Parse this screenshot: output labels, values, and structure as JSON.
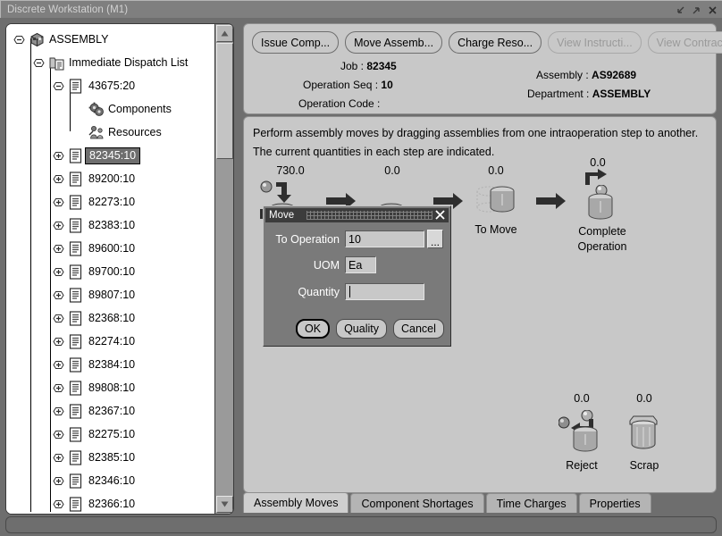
{
  "window": {
    "title": "Discrete Workstation (M1)",
    "controls": [
      {
        "name": "minimize-button",
        "glyph": "minimize"
      },
      {
        "name": "maximize-button",
        "glyph": "maximize"
      },
      {
        "name": "close-button",
        "glyph": "close"
      }
    ]
  },
  "tree": {
    "nodes": [
      {
        "label": "ASSEMBLY",
        "depth": 0,
        "icon": "cube-icon",
        "handle": "collapse",
        "selected": false
      },
      {
        "label": "Immediate Dispatch List",
        "depth": 1,
        "icon": "folder-doc-icon",
        "handle": "collapse",
        "selected": false
      },
      {
        "label": "43675:20",
        "depth": 2,
        "icon": "document-icon",
        "handle": "collapse",
        "selected": false
      },
      {
        "label": "Components",
        "depth": 3,
        "icon": "gears-icon",
        "handle": "none",
        "selected": false
      },
      {
        "label": "Resources",
        "depth": 3,
        "icon": "resources-icon",
        "handle": "none",
        "selected": false
      },
      {
        "label": "82345:10",
        "depth": 2,
        "icon": "document-icon",
        "handle": "expand",
        "selected": true
      },
      {
        "label": "89200:10",
        "depth": 2,
        "icon": "document-icon",
        "handle": "expand",
        "selected": false
      },
      {
        "label": "82273:10",
        "depth": 2,
        "icon": "document-icon",
        "handle": "expand",
        "selected": false
      },
      {
        "label": "82383:10",
        "depth": 2,
        "icon": "document-icon",
        "handle": "expand",
        "selected": false
      },
      {
        "label": "89600:10",
        "depth": 2,
        "icon": "document-icon",
        "handle": "expand",
        "selected": false
      },
      {
        "label": "89700:10",
        "depth": 2,
        "icon": "document-icon",
        "handle": "expand",
        "selected": false
      },
      {
        "label": "89807:10",
        "depth": 2,
        "icon": "document-icon",
        "handle": "expand",
        "selected": false
      },
      {
        "label": "82368:10",
        "depth": 2,
        "icon": "document-icon",
        "handle": "expand",
        "selected": false
      },
      {
        "label": "82274:10",
        "depth": 2,
        "icon": "document-icon",
        "handle": "expand",
        "selected": false
      },
      {
        "label": "82384:10",
        "depth": 2,
        "icon": "document-icon",
        "handle": "expand",
        "selected": false
      },
      {
        "label": "89808:10",
        "depth": 2,
        "icon": "document-icon",
        "handle": "expand",
        "selected": false
      },
      {
        "label": "82367:10",
        "depth": 2,
        "icon": "document-icon",
        "handle": "expand",
        "selected": false
      },
      {
        "label": "82275:10",
        "depth": 2,
        "icon": "document-icon",
        "handle": "expand",
        "selected": false
      },
      {
        "label": "82385:10",
        "depth": 2,
        "icon": "document-icon",
        "handle": "expand",
        "selected": false
      },
      {
        "label": "82346:10",
        "depth": 2,
        "icon": "document-icon",
        "handle": "expand",
        "selected": false
      },
      {
        "label": "82366:10",
        "depth": 2,
        "icon": "document-icon",
        "handle": "expand",
        "selected": false
      }
    ]
  },
  "toolbar": {
    "buttons": [
      {
        "label": "Issue Comp...",
        "name": "issue-components-button",
        "disabled": false
      },
      {
        "label": "Move Assemb...",
        "name": "move-assemblies-button",
        "disabled": false
      },
      {
        "label": "Charge Reso...",
        "name": "charge-resources-button",
        "disabled": false
      },
      {
        "label": "View Instructi...",
        "name": "view-instructions-button",
        "disabled": true
      },
      {
        "label": "View Contract",
        "name": "view-contract-button",
        "disabled": true
      }
    ]
  },
  "jobinfo": {
    "job_label": "Job :",
    "job_value": "82345",
    "operation_seq_label": "Operation Seq :",
    "operation_seq_value": "10",
    "operation_code_label": "Operation Code :",
    "operation_code_value": "",
    "assembly_label": "Assembly :",
    "assembly_value": "AS92689",
    "department_label": "Department :",
    "department_value": "ASSEMBLY"
  },
  "instructions": {
    "line1": "Perform assembly moves by dragging assemblies from one intraoperation step to another.",
    "line2": "The current quantities in each step are indicated."
  },
  "diagram": {
    "steps": [
      {
        "name": "queue-step",
        "qty": "730.0",
        "label": "",
        "icon": "conveyor-in-icon"
      },
      {
        "name": "run-step",
        "qty": "0.0",
        "label": "",
        "icon": "conveyor-icon"
      },
      {
        "name": "to-move-step",
        "qty": "0.0",
        "label": "To Move",
        "icon": "barrel-dashed-icon"
      },
      {
        "name": "complete-step",
        "qty": "0.0",
        "label": "Complete\nOperation",
        "icon": "barrel-out-icon"
      },
      {
        "name": "reject-step",
        "qty": "0.0",
        "label": "Reject",
        "icon": "barrel-reject-icon"
      },
      {
        "name": "scrap-step",
        "qty": "0.0",
        "label": "Scrap",
        "icon": "scrap-bin-icon"
      }
    ],
    "complete_label_line1": "Complete",
    "complete_label_line2": "Operation",
    "to_move_label": "To Move",
    "reject_label": "Reject",
    "scrap_label": "Scrap"
  },
  "tabs": [
    {
      "label": "Assembly Moves",
      "name": "tab-assembly-moves",
      "active": true
    },
    {
      "label": "Component Shortages",
      "name": "tab-component-shortages",
      "active": false
    },
    {
      "label": "Time Charges",
      "name": "tab-time-charges",
      "active": false
    },
    {
      "label": "Properties",
      "name": "tab-properties",
      "active": false
    }
  ],
  "move_dialog": {
    "title": "Move",
    "to_operation_label": "To Operation",
    "to_operation_value": "10",
    "uom_label": "UOM",
    "uom_value": "Ea",
    "quantity_label": "Quantity",
    "quantity_value": "",
    "lov_button_label": "...",
    "buttons": [
      {
        "label": "OK",
        "name": "ok-button",
        "default": true
      },
      {
        "label": "Quality",
        "name": "quality-button",
        "default": false
      },
      {
        "label": "Cancel",
        "name": "cancel-button",
        "default": false
      }
    ]
  },
  "colors": {
    "desktop": "#6e6e6e",
    "panel": "#c8c8c8",
    "selection": "#6e6e6e",
    "dialog": "#7a7a7a",
    "dialog_title": "#3c3c3c"
  }
}
